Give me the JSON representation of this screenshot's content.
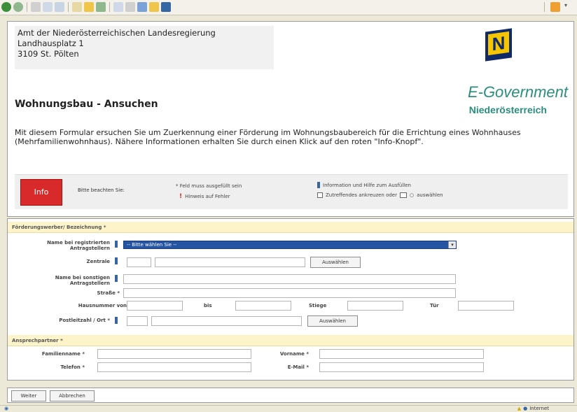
{
  "header": {
    "address_lines": [
      "Amt der Niederösterreichischen Landesregierung",
      "Landhausplatz 1",
      "3109 St. Pölten"
    ],
    "logo_letter": "N",
    "egov_title": "E-Government",
    "egov_subtitle": "Niederösterreich",
    "page_title": "Wohnungsbau - Ansuchen",
    "intro": "Mit diesem Formular ersuchen Sie um Zuerkennung einer Förderung im Wohnungsbaubereich für die Errichtung eines Wohnhauses (Mehrfamilienwohnhaus). Nähere Informationen erhalten Sie durch einen Klick auf den roten \"Info-Knopf\"."
  },
  "info_panel": {
    "info_button": "Info",
    "note_label": "Bitte beachten Sie:",
    "legend_required": "* Feld muss ausgefüllt sein",
    "legend_error": "Hinweis auf Fehler",
    "legend_help": "Information und Hilfe zum Ausfüllen",
    "legend_checkbox": "Zutreffendes ankreuzen oder",
    "legend_select": "auswählen"
  },
  "section1": {
    "title": "Förderungswerber/ Bezeichnung *",
    "label_registered": "Name bei registrierten Antragstellern",
    "select_value": "-- Bitte wählen Sie --",
    "label_zentrale": "Zentrale",
    "label_other": "Name bei sonstigen Antragstellern",
    "label_street": "Straße *",
    "label_housenr": "Hausnummer von",
    "label_to": "bis",
    "label_floor": "Stiege",
    "label_door": "Tür",
    "label_zip": "Postleitzahl / Ort *",
    "select_button": "Auswählen",
    "select_button2": "Auswählen"
  },
  "section2": {
    "title": "Ansprechpartner *",
    "label_lastname": "Familienname *",
    "label_firstname": "Vorname *",
    "label_phone": "Telefon *",
    "label_email": "E-Mail *"
  },
  "footer": {
    "btn_next": "Weiter",
    "btn_abort": "Abbrechen"
  },
  "statusbar": {
    "zone": "Internet"
  },
  "colors": {
    "accent": "#2a8f7d",
    "info_red": "#d82a2a",
    "select_blue": "#2554a2",
    "section_bg": "#fdf4c9"
  }
}
